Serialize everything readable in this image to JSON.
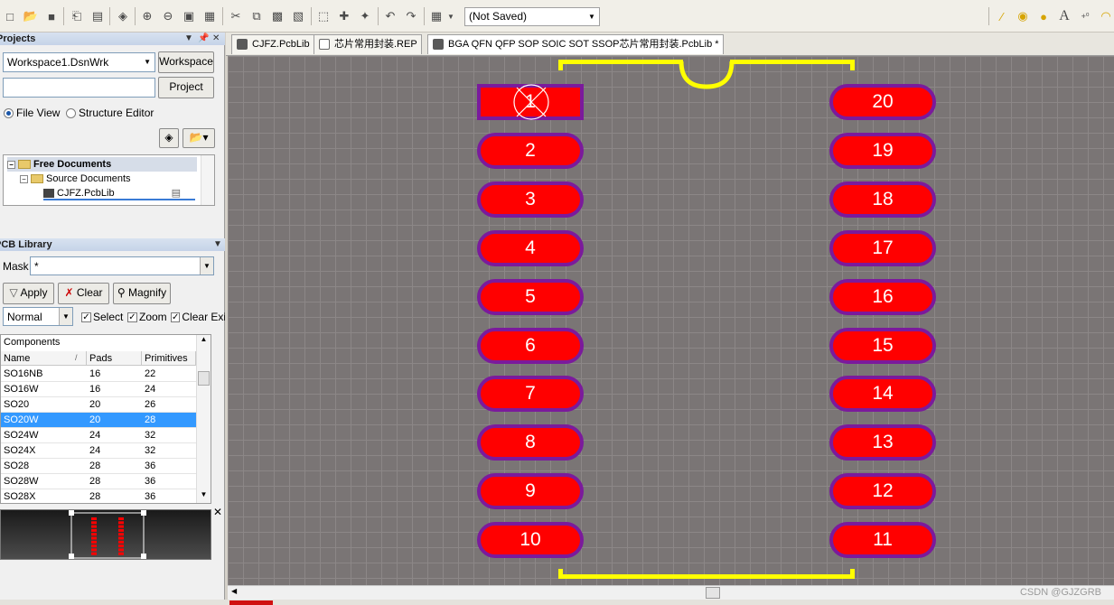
{
  "toolbar": {
    "saved_combo": "(Not Saved)",
    "icons": [
      "new-file-icon",
      "open-folder-icon",
      "save-icon",
      "print-icon",
      "print-preview-icon",
      "layers-icon",
      "zoom-in-icon",
      "zoom-out-icon",
      "zoom-fit-icon",
      "zoom-area-icon",
      "cut-icon",
      "copy-icon",
      "paste-icon",
      "paste-special-icon",
      "select-rect-icon",
      "move-icon",
      "cross-select-icon",
      "undo-icon",
      "redo-icon",
      "grid-icon",
      "line-tool-icon",
      "pad-tool-icon",
      "via-tool-icon",
      "text-tool-icon",
      "coordinate-icon",
      "arc-tool-icon"
    ]
  },
  "projects": {
    "title": "Projects",
    "workspace_value": "Workspace1.DsnWrk",
    "workspace_button": "Workspace",
    "project_value": "",
    "project_button": "Project",
    "radio_file_view": "File View",
    "radio_structure": "Structure Editor",
    "tree": {
      "root": "Free Documents",
      "child": "Source Documents",
      "leaf": "CJFZ.PcbLib"
    }
  },
  "pcb_library": {
    "title": "PCB Library",
    "mask_label": "Mask",
    "mask_value": "*",
    "apply": "Apply",
    "clear": "Clear",
    "magnify": "Magnify",
    "mode": "Normal",
    "chk_select": "Select",
    "chk_zoom": "Zoom",
    "chk_clear": "Clear Exi",
    "components_title": "Components",
    "columns": [
      "Name",
      "Pads",
      "Primitives"
    ],
    "rows": [
      {
        "name": "SO16NB",
        "pads": "16",
        "prims": "22"
      },
      {
        "name": "SO16W",
        "pads": "16",
        "prims": "24"
      },
      {
        "name": "SO20",
        "pads": "20",
        "prims": "26"
      },
      {
        "name": "SO20W",
        "pads": "20",
        "prims": "28"
      },
      {
        "name": "SO24W",
        "pads": "24",
        "prims": "32"
      },
      {
        "name": "SO24X",
        "pads": "24",
        "prims": "32"
      },
      {
        "name": "SO28",
        "pads": "28",
        "prims": "36"
      },
      {
        "name": "SO28W",
        "pads": "28",
        "prims": "36"
      },
      {
        "name": "SO28X",
        "pads": "28",
        "prims": "36"
      }
    ],
    "selected_index": 3
  },
  "tabs": [
    {
      "label": "CJFZ.PcbLib"
    },
    {
      "label": "芯片常用封装.REP"
    },
    {
      "label": "BGA QFN QFP SOP SOIC SOT SSOP芯片常用封装.PcbLib *"
    }
  ],
  "colors": {
    "pad_fill": "#ff0000",
    "pad_ring": "#7b1a9c",
    "silkscreen": "#ffff00",
    "selection": "#3399ff"
  },
  "pads_left": [
    "1",
    "2",
    "3",
    "4",
    "5",
    "6",
    "7",
    "8",
    "9",
    "10"
  ],
  "pads_right": [
    "20",
    "19",
    "18",
    "17",
    "16",
    "15",
    "14",
    "13",
    "12",
    "11"
  ],
  "watermark": "CSDN @GJZGRB"
}
